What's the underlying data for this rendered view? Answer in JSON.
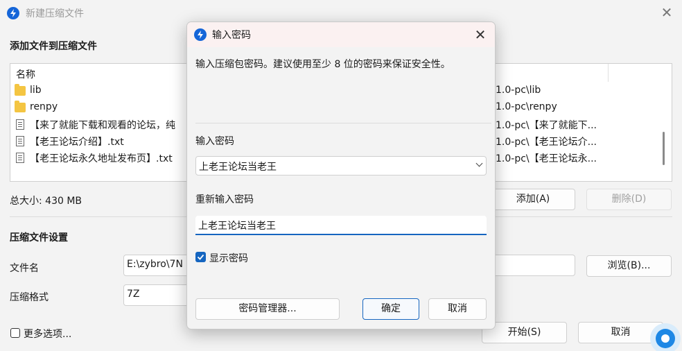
{
  "main_window": {
    "title": "新建压缩文件",
    "add_section_title": "添加文件到压缩文件",
    "list": {
      "column_name": "名称",
      "rows": [
        {
          "type": "folder",
          "name": "lib",
          "path": "1.0-pc\\lib"
        },
        {
          "type": "folder",
          "name": "renpy",
          "path": "1.0-pc\\renpy"
        },
        {
          "type": "file",
          "name": "【来了就能下载和观看的论坛，纯",
          "path": "1.0-pc\\【来了就能下..."
        },
        {
          "type": "file",
          "name": "【老王论坛介绍】.txt",
          "path": "1.0-pc\\【老王论坛介..."
        },
        {
          "type": "file",
          "name": "【老王论坛永久地址发布页】.txt",
          "path": "1.0-pc\\【老王论坛永..."
        }
      ]
    },
    "total_size": "总大小: 430 MB",
    "add_button": "添加(A)",
    "delete_button": "删除(D)",
    "settings_title": "压缩文件设置",
    "filename_label": "文件名",
    "filename_value": "E:\\zybro\\7N",
    "browse_button": "浏览(B)...",
    "format_label": "压缩格式",
    "format_value": "7Z",
    "more_options": "更多选项...",
    "start_button": "开始(S)",
    "cancel_button": "取消"
  },
  "dialog": {
    "title": "输入密码",
    "description": "输入压缩包密码。建议使用至少 8 位的密码来保证安全性。",
    "password_label": "输入密码",
    "password_value": "上老王论坛当老王",
    "reenter_label": "重新输入密码",
    "reenter_value": "上老王论坛当老王",
    "show_password_label": "显示密码",
    "show_password_checked": true,
    "manager_button": "密码管理器...",
    "ok_button": "确定",
    "cancel_button": "取消"
  },
  "colors": {
    "accent": "#1565c0",
    "app_icon": "#1565d8",
    "dialog_titlebar": "#fbf1f1"
  }
}
